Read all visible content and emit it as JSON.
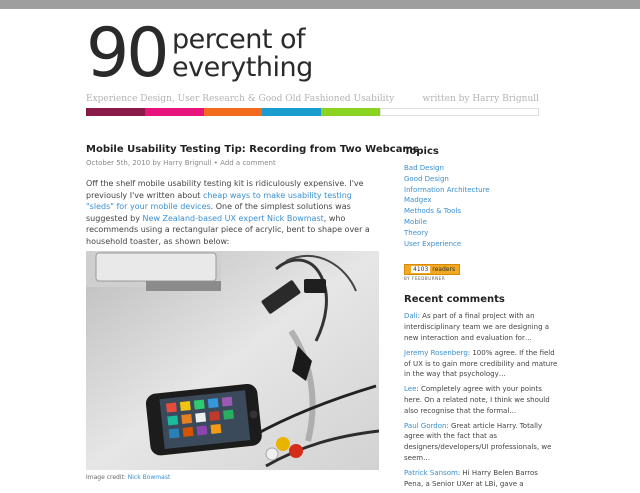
{
  "header": {
    "logo_number": "90",
    "logo_line1": "percent of",
    "logo_line2": "everything",
    "tagline": "Experience Design, User Research & Good Old Fashioned Usability",
    "byline": "written by Harry Brignull",
    "color_segments": [
      "#8a1a4a",
      "#e8147e",
      "#f26a1b",
      "#1a9cd0",
      "#8bd321"
    ]
  },
  "post": {
    "title": "Mobile Usability Testing Tip: Recording from Two Webcams",
    "date": "October 5th, 2010 by Harry Brignull",
    "separator": " • ",
    "comment_link": "Add a comment",
    "p1_a": "Off the shelf mobile usability testing kit is ridiculously expensive. I've previously I've written about ",
    "p1_link1": "cheap ways to make usability testing \"sleds\" for your mobile devices",
    "p1_b": ". One of the simplest solutions was suggested by ",
    "p1_link2": "New Zealand-based UX expert Nick Bowmast",
    "p1_c": ", who recommends using a rectangular piece of acrylic, bent to shape over a household toaster, as shown below:",
    "credit_label": "Image credit: ",
    "credit_link": "Nick Bowmast"
  },
  "sidebar": {
    "topics_heading": "Topics",
    "topics": [
      "Bad Design",
      "Good Design",
      "Information Architecture",
      "Madgex",
      "Methods & Tools",
      "Mobile",
      "Theory",
      "User Experience"
    ],
    "feed_count": "4103",
    "feed_label": "readers",
    "feed_by": "BY FEEDBURNER",
    "recent_heading": "Recent comments",
    "comments": [
      {
        "author": "Dali",
        "text": ": As part of a final project with an interdisciplinary team we are designing a new interaction and evaluation for…"
      },
      {
        "author": "Jeremy Rosenberg",
        "text": ": 100% agree. If the field of UX is to gain more credibility and mature in the way that psychology…"
      },
      {
        "author": "Lee",
        "text": ": Completely agree with your points here. On a related note, I think we should also recognise that the formal…"
      },
      {
        "author": "Paul Gordon",
        "text": ": Great article Harry. Totally agree with the fact that as designers/developers/UI professionals, we seem…"
      },
      {
        "author": "Patrick Sansom",
        "text": ": Hi Harry Belen Barros Pena, a Senior UXer at LBi, gave a"
      }
    ]
  }
}
